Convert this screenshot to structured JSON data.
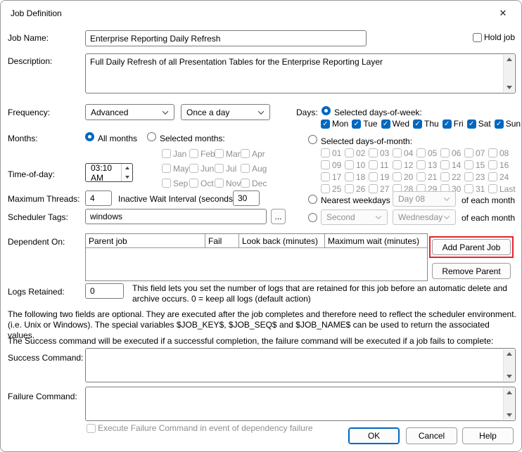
{
  "colors": {
    "accent": "#0067c0",
    "annotation_red": "#e5232b"
  },
  "icons": {
    "close": "✕",
    "check": "✓"
  },
  "title_bar": {
    "title": "Job Definition"
  },
  "job_name": {
    "label": "Job Name:",
    "value": "Enterprise Reporting Daily Refresh"
  },
  "hold_job": {
    "label": "Hold job"
  },
  "description": {
    "label": "Description:",
    "value": "Full Daily Refresh of all Presentation Tables for the Enterprise Reporting Layer"
  },
  "frequency": {
    "label": "Frequency:",
    "primary": "Advanced",
    "secondary": "Once a day"
  },
  "days": {
    "label": "Days:",
    "option": "Selected days-of-week:",
    "weekdays": [
      "Mon",
      "Tue",
      "Wed",
      "Thu",
      "Fri",
      "Sat",
      "Sun"
    ]
  },
  "months": {
    "label": "Months:",
    "all_option": "All months",
    "selected_option": "Selected months:",
    "names": [
      "Jan",
      "Feb",
      "Mar",
      "Apr",
      "May",
      "Jun",
      "Jul",
      "Aug",
      "Sep",
      "Oct",
      "Nov",
      "Dec"
    ]
  },
  "days_of_month": {
    "option": "Selected days-of-month:",
    "cells": [
      "01",
      "02",
      "03",
      "04",
      "05",
      "06",
      "07",
      "08",
      "09",
      "10",
      "11",
      "12",
      "13",
      "14",
      "15",
      "16",
      "17",
      "18",
      "19",
      "20",
      "21",
      "22",
      "23",
      "24",
      "25",
      "26",
      "27",
      "28",
      "29",
      "30",
      "31",
      "Last"
    ]
  },
  "time_of_day": {
    "label": "Time-of-day:",
    "value": "03:10 AM"
  },
  "threads": {
    "label": "Maximum Threads:",
    "value": "4"
  },
  "inactive_wait": {
    "label": "Inactive Wait Interval (seconds):",
    "value": "30"
  },
  "nearest_weekday": {
    "option": "Nearest weekdays to",
    "dropdown": "Day 08",
    "suffix": "of each month"
  },
  "ordinal_weekday": {
    "ordinal": "Second",
    "weekday": "Wednesday",
    "suffix": "of each month"
  },
  "scheduler_tags": {
    "label": "Scheduler Tags:",
    "value": "windows",
    "browse_label": "..."
  },
  "dependents": {
    "label": "Dependent On:",
    "columns": [
      "Parent job",
      "Fail",
      "Look back (minutes)",
      "Maximum wait (minutes)"
    ],
    "add_label": "Add Parent Job",
    "remove_label": "Remove Parent"
  },
  "logs_retained": {
    "label": "Logs Retained:",
    "value": "0",
    "help": "This field lets you set the number of logs that are retained for this job before an automatic delete and archive occurs. 0 = keep all logs (default action)"
  },
  "notes": {
    "optional_fields": "The following two fields are optional. They are executed after the job completes and therefore need to reflect the scheduler environment. (i.e. Unix or Windows). The special variables $JOB_KEY$, $JOB_SEQ$ and $JOB_NAME$ can be used to return the associated values.",
    "command_execution": "The Success command will be executed if a successful completion, the failure command will be executed if a job fails to complete:"
  },
  "success_command": {
    "label": "Success Command:",
    "value": ""
  },
  "failure_command": {
    "label": "Failure Command:",
    "value": ""
  },
  "dependency_failure": {
    "label": "Execute Failure Command in event of dependency failure"
  },
  "footer": {
    "ok": "OK",
    "cancel": "Cancel",
    "help": "Help"
  }
}
